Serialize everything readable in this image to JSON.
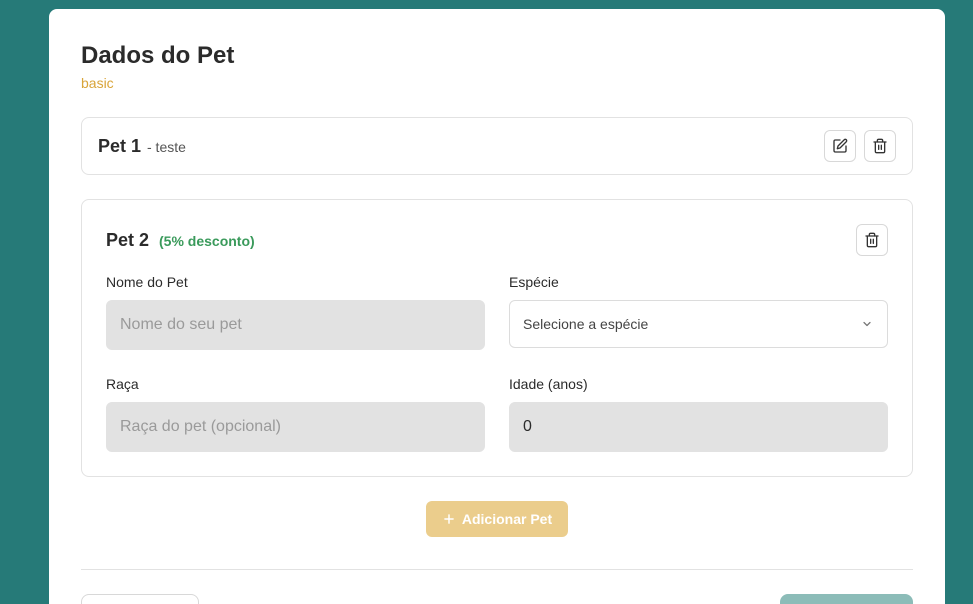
{
  "header": {
    "title": "Dados do Pet",
    "plan": "basic"
  },
  "pets": [
    {
      "name": "Pet 1",
      "subtitle": "- teste"
    },
    {
      "name": "Pet 2",
      "discount": "(5% desconto)",
      "fields": {
        "name_label": "Nome do Pet",
        "name_placeholder": "Nome do seu pet",
        "species_label": "Espécie",
        "species_value": "Selecione a espécie",
        "breed_label": "Raça",
        "breed_placeholder": "Raça do pet (opcional)",
        "age_label": "Idade (anos)",
        "age_value": "0"
      }
    }
  ],
  "actions": {
    "add_pet_label": "Adicionar Pet",
    "add_pet_icon": "plus-icon"
  },
  "colors": {
    "background": "#267a78",
    "plan": "#d9a53a",
    "discount": "#3a9a5b",
    "add_button": "#ebcd8c",
    "next_button": "#8cbcb8"
  }
}
